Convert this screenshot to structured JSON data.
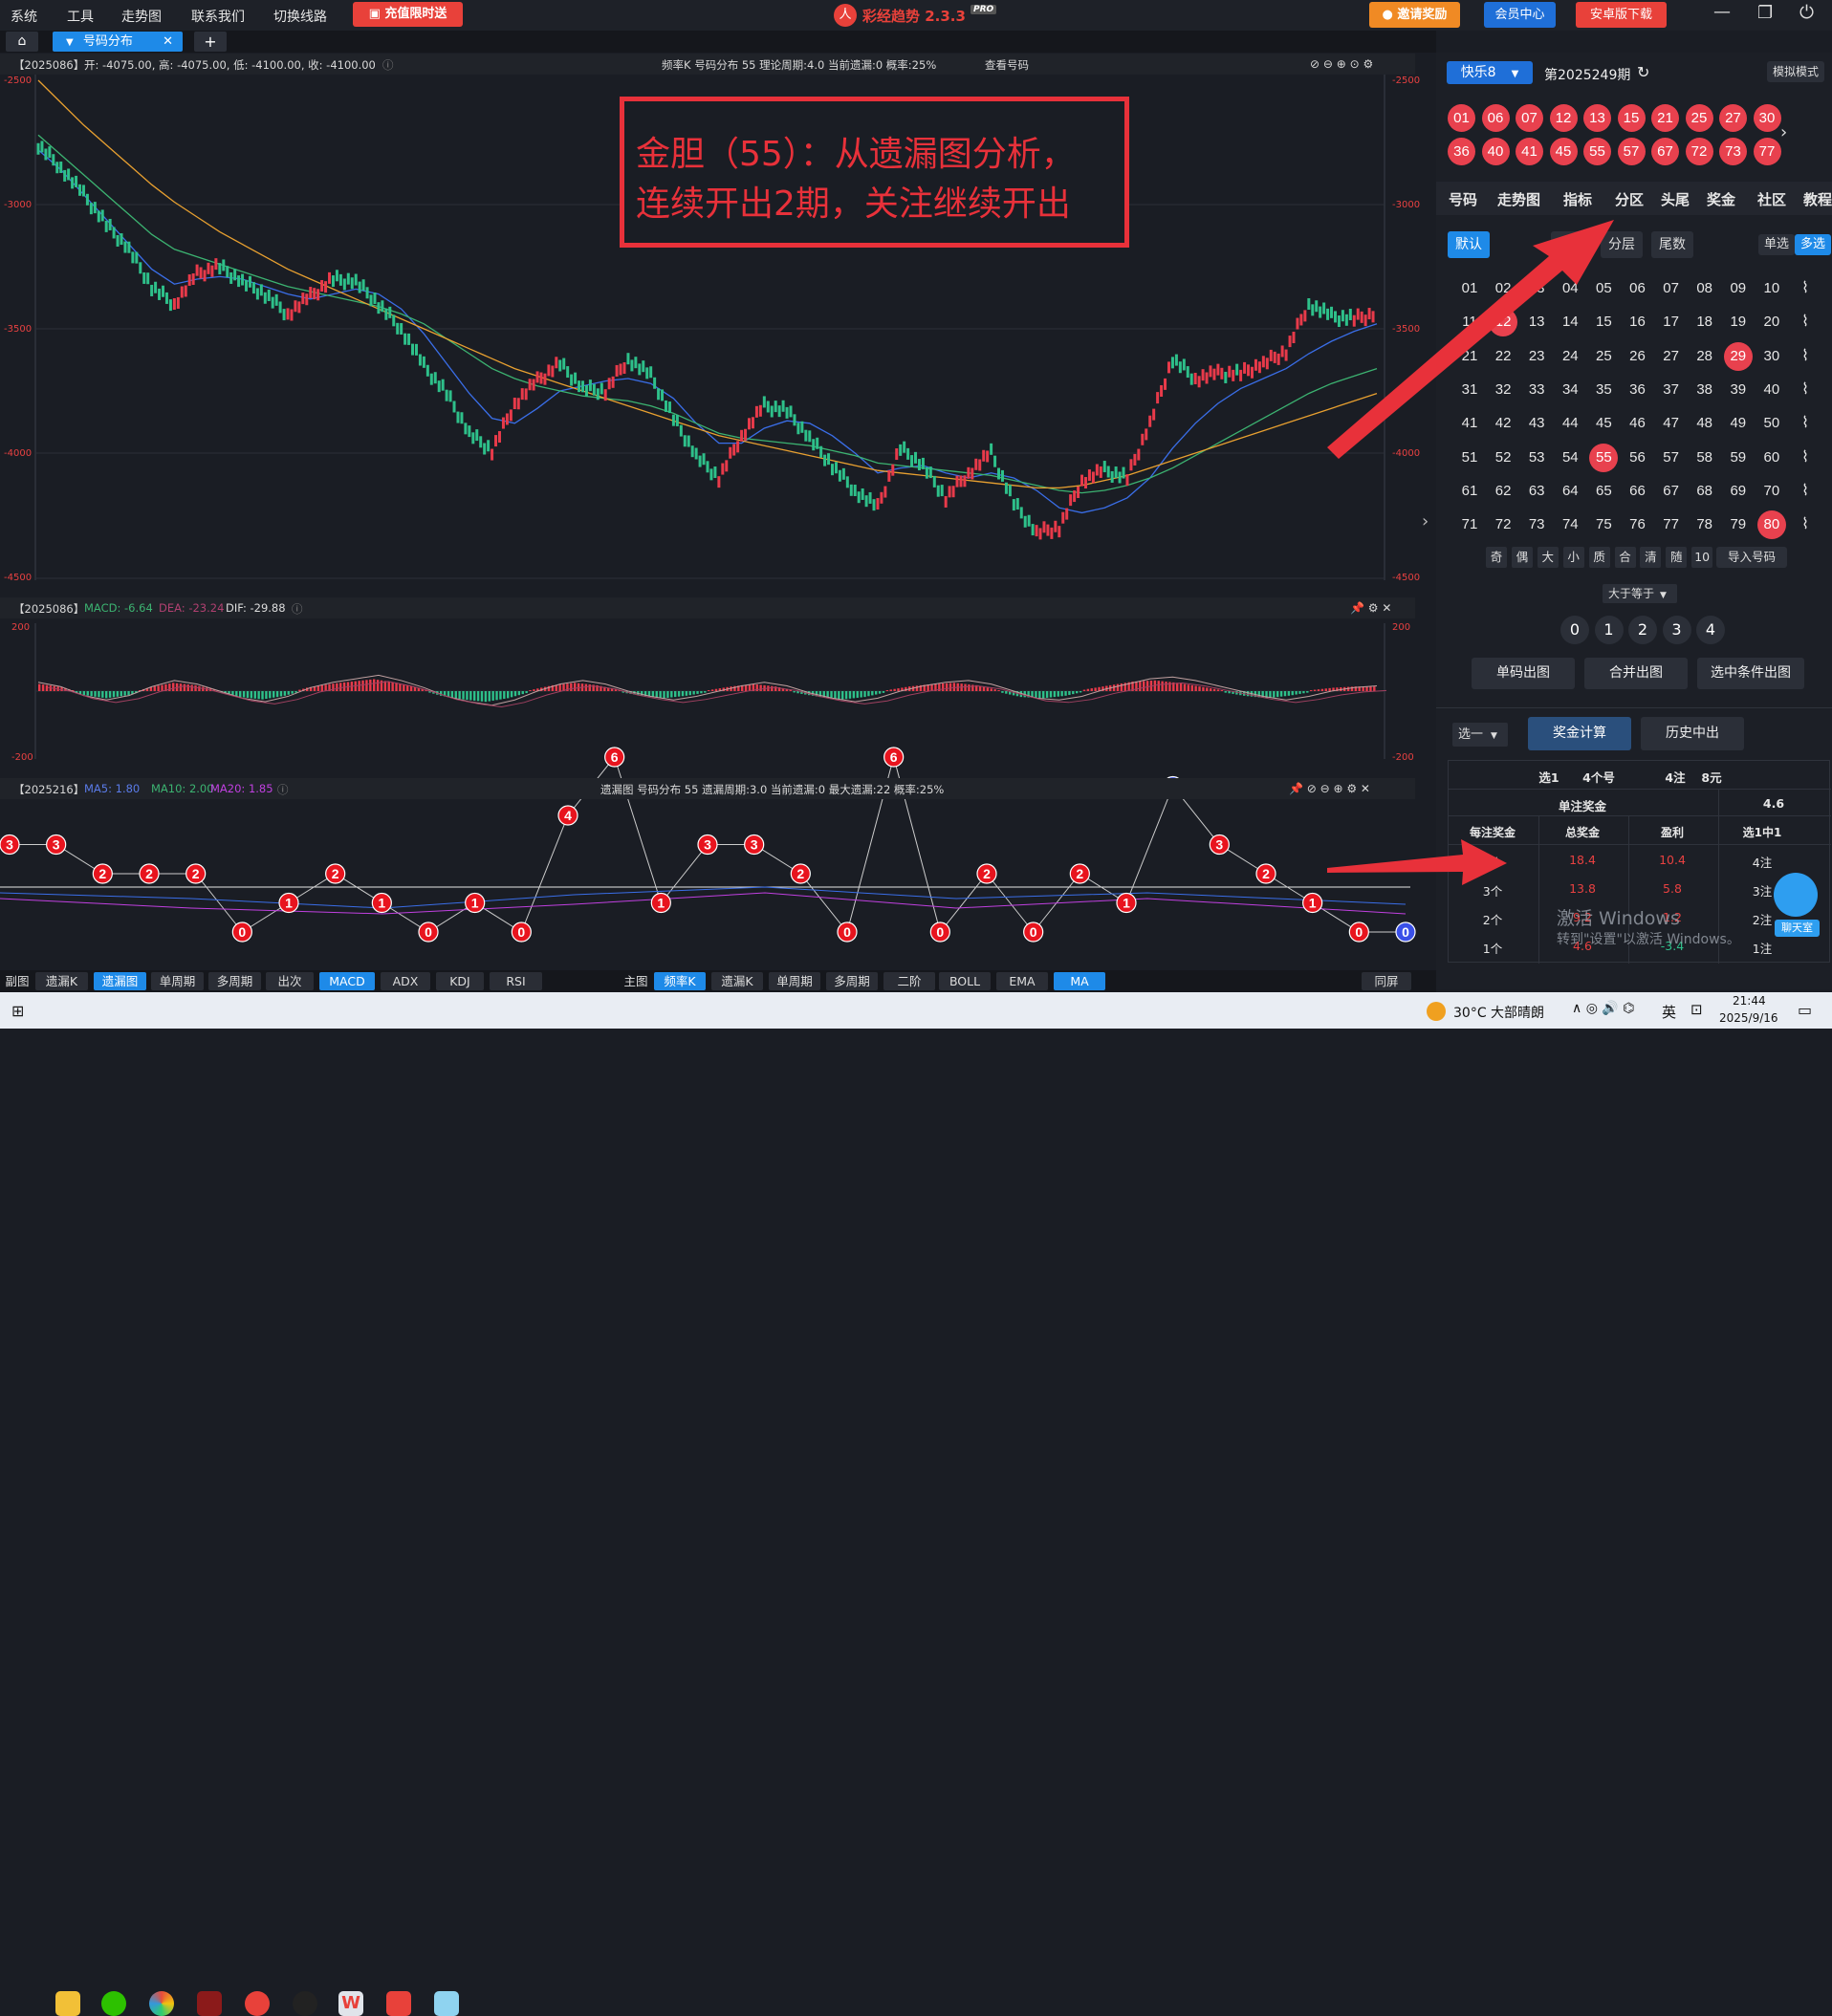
{
  "menu": [
    "系统",
    "工具",
    "走势图",
    "联系我们",
    "切换线路"
  ],
  "promo_label": "充值限时送",
  "app_title": "彩经趋势 2.3.3",
  "app_badge": "PRO",
  "invite_label": "邀请奖励",
  "member_label": "会员中心",
  "android_label": "安卓版下载",
  "tab": {
    "label": "号码分布"
  },
  "kline_header": {
    "period": "【2025086】",
    "ohlc": "开: -4075.00, 高: -4075.00, 低: -4100.00, 收: -4100.00",
    "center": "频率K   号码分布  55     理论周期:4.0   当前遗漏:0   概率:25%",
    "check": "查看号码"
  },
  "annotation": {
    "line1": "金胆（55）：从遗漏图分析，",
    "line2": "连续开出2期，关注继续开出"
  },
  "kline_axis": {
    "left": [
      "-2500",
      "-3000",
      "-3500",
      "-4000",
      "-4500"
    ],
    "right": [
      "-2500",
      "-3000",
      "-3500",
      "-4000",
      "-4500"
    ]
  },
  "macd_header": {
    "period": "【2025086】",
    "macd": "MACD: -6.64",
    "dea": "DEA: -23.24",
    "dif": "DIF: -29.88"
  },
  "macd_axis": {
    "top": "200",
    "bottom": "-200"
  },
  "omit_header": {
    "period": "【2025216】",
    "ma5": "MA5: 1.80",
    "ma10": "MA10: 2.00",
    "ma20": "MA20: 1.85",
    "center": "遗漏图    号码分布   55      遗漏周期:3.0    当前遗漏:0    最大遗漏:22    概率:25%"
  },
  "chart_data": [
    {
      "type": "line",
      "title": "频率K 号码分布 55",
      "ylim": [
        -4500,
        -2500
      ],
      "series": [
        {
          "name": "K",
          "values": [
            -2760,
            -2850,
            -2960,
            -3080,
            -3180,
            -3330,
            -3400,
            -3280,
            -3250,
            -3310,
            -3360,
            -3440,
            -3370,
            -3300,
            -3310,
            -3400,
            -3500,
            -3650,
            -3760,
            -3920,
            -3990,
            -3800,
            -3710,
            -3640,
            -3740,
            -3750,
            -3620,
            -3690,
            -3860,
            -4010,
            -4100,
            -3930,
            -3810,
            -3830,
            -3940,
            -4050,
            -4150,
            -4220,
            -3980,
            -4050,
            -4180,
            -4080,
            -4000,
            -4200,
            -4320,
            -4300,
            -4110,
            -4070,
            -4100,
            -3880,
            -3620,
            -3700,
            -3680,
            -3680,
            -3640,
            -3590,
            -3400,
            -3450,
            -3460,
            -3440
          ]
        },
        {
          "name": "MA5",
          "values": [
            -2780,
            -2860,
            -2960,
            -3060,
            -3160,
            -3260,
            -3320,
            -3300,
            -3290,
            -3300,
            -3330,
            -3360,
            -3380,
            -3360,
            -3340,
            -3360,
            -3420,
            -3520,
            -3640,
            -3760,
            -3860,
            -3880,
            -3820,
            -3750,
            -3730,
            -3710,
            -3700,
            -3720,
            -3780,
            -3880,
            -3960,
            -3960,
            -3900,
            -3870,
            -3880,
            -3930,
            -4000,
            -4080,
            -4060,
            -4050,
            -4080,
            -4100,
            -4080,
            -4100,
            -4150,
            -4220,
            -4240,
            -4220,
            -4180,
            -4100,
            -3980,
            -3880,
            -3800,
            -3740,
            -3700,
            -3660,
            -3600,
            -3550,
            -3510,
            -3480
          ]
        },
        {
          "name": "MA10",
          "values": [
            -2720,
            -2800,
            -2880,
            -2960,
            -3040,
            -3120,
            -3180,
            -3210,
            -3240,
            -3270,
            -3300,
            -3330,
            -3350,
            -3370,
            -3390,
            -3410,
            -3440,
            -3480,
            -3540,
            -3600,
            -3660,
            -3700,
            -3730,
            -3750,
            -3770,
            -3780,
            -3790,
            -3810,
            -3840,
            -3880,
            -3920,
            -3940,
            -3950,
            -3960,
            -3970,
            -3990,
            -4010,
            -4040,
            -4050,
            -4060,
            -4070,
            -4080,
            -4090,
            -4110,
            -4130,
            -4150,
            -4160,
            -4150,
            -4130,
            -4100,
            -4060,
            -4010,
            -3960,
            -3910,
            -3860,
            -3810,
            -3760,
            -3720,
            -3690,
            -3660
          ]
        },
        {
          "name": "MA20",
          "values": [
            -2500,
            -2590,
            -2680,
            -2760,
            -2840,
            -2920,
            -2990,
            -3050,
            -3110,
            -3160,
            -3210,
            -3260,
            -3300,
            -3340,
            -3380,
            -3420,
            -3460,
            -3500,
            -3540,
            -3580,
            -3620,
            -3660,
            -3690,
            -3720,
            -3750,
            -3780,
            -3810,
            -3840,
            -3870,
            -3900,
            -3930,
            -3950,
            -3970,
            -3990,
            -4010,
            -4030,
            -4050,
            -4070,
            -4080,
            -4090,
            -4100,
            -4110,
            -4120,
            -4130,
            -4140,
            -4140,
            -4130,
            -4110,
            -4090,
            -4060,
            -4030,
            -4000,
            -3970,
            -3940,
            -3910,
            -3880,
            -3850,
            -3820,
            -3790,
            -3760
          ]
        }
      ]
    },
    {
      "type": "bar",
      "title": "MACD",
      "ylim": [
        -200,
        200
      ],
      "series": [
        {
          "name": "MACD",
          "values": [
            10,
            5,
            -5,
            -10,
            -5,
            5,
            12,
            8,
            0,
            -8,
            -12,
            -6,
            4,
            10,
            14,
            18,
            12,
            4,
            -6,
            -12,
            -16,
            -10,
            0,
            8,
            12,
            8,
            0,
            -6,
            -10,
            -6,
            0,
            6,
            10,
            6,
            -2,
            -8,
            -12,
            -8,
            0,
            6,
            10,
            12,
            8,
            0,
            -8,
            -10,
            -6,
            2,
            8,
            14,
            16,
            12,
            6,
            0,
            -6,
            -10,
            -6,
            0,
            4,
            6
          ]
        }
      ]
    },
    {
      "type": "scatter",
      "title": "遗漏图 号码分布 55",
      "series": [
        {
          "name": "遗漏",
          "values": [
            3,
            3,
            2,
            2,
            2,
            0,
            1,
            2,
            1,
            0,
            1,
            0,
            4,
            6,
            1,
            3,
            3,
            2,
            0,
            6,
            0,
            2,
            0,
            2,
            1,
            5,
            3,
            2,
            1,
            0,
            0
          ]
        }
      ]
    }
  ],
  "right": {
    "lottery": "快乐8",
    "issue": "第2025249期",
    "mode": "模拟模式",
    "draw_row1": [
      "01",
      "06",
      "07",
      "12",
      "13",
      "15",
      "21",
      "25",
      "27",
      "30"
    ],
    "draw_row2": [
      "36",
      "40",
      "41",
      "45",
      "55",
      "57",
      "67",
      "72",
      "73",
      "77"
    ],
    "nav_tabs": [
      "号码",
      "走势图",
      "指标",
      "分区",
      "头尾",
      "奖金",
      "社区",
      "教程"
    ],
    "subtabs": [
      "默认",
      "冷热",
      "分层",
      "尾数"
    ],
    "single": "单选",
    "multi": "多选",
    "grid": [
      [
        "01",
        "02",
        "03",
        "04",
        "05",
        "06",
        "07",
        "08",
        "09",
        "10"
      ],
      [
        "11",
        "12",
        "13",
        "14",
        "15",
        "16",
        "17",
        "18",
        "19",
        "20"
      ],
      [
        "21",
        "22",
        "23",
        "24",
        "25",
        "26",
        "27",
        "28",
        "29",
        "30"
      ],
      [
        "31",
        "32",
        "33",
        "34",
        "35",
        "36",
        "37",
        "38",
        "39",
        "40"
      ],
      [
        "41",
        "42",
        "43",
        "44",
        "45",
        "46",
        "47",
        "48",
        "49",
        "50"
      ],
      [
        "51",
        "52",
        "53",
        "54",
        "55",
        "56",
        "57",
        "58",
        "59",
        "60"
      ],
      [
        "61",
        "62",
        "63",
        "64",
        "65",
        "66",
        "67",
        "68",
        "69",
        "70"
      ],
      [
        "71",
        "72",
        "73",
        "74",
        "75",
        "76",
        "77",
        "78",
        "79",
        "80"
      ]
    ],
    "filters": [
      "奇",
      "偶",
      "大",
      "小",
      "质",
      "合",
      "清",
      "随",
      "10"
    ],
    "import": "导入号码",
    "ge": "大于等于",
    "omits": [
      "0",
      "1",
      "2",
      "3",
      "4"
    ],
    "btn_single": "单码出图",
    "btn_merge": "合并出图",
    "btn_cond": "选中条件出图",
    "pick": "选一",
    "calc": "奖金计算",
    "history": "历史中出",
    "summary": [
      "选1",
      "4个号",
      "4注",
      "8元"
    ],
    "single_bonus_label": "单注奖金",
    "single_bonus_value": "4.6",
    "col_headers": [
      "每注奖金",
      "总奖金",
      "盈利",
      "选1中1"
    ],
    "rows": [
      [
        "4个",
        "18.4",
        "10.4",
        "4注"
      ],
      [
        "3个",
        "13.8",
        "5.8",
        "3注"
      ],
      [
        "2个",
        "9.2",
        "1.2",
        "2注"
      ],
      [
        "1个",
        "4.6",
        "-3.4",
        "1注"
      ]
    ],
    "activate1": "激活 Windows",
    "activate2": "转到\"设置\"以激活 Windows。",
    "chat": "聊天室"
  },
  "bottom_left": [
    "副图",
    "遗漏K",
    "遗漏图",
    "单周期",
    "多周期",
    "出次",
    "MACD",
    "ADX",
    "KDJ",
    "RSI"
  ],
  "bottom_right": [
    "主图",
    "频率K",
    "遗漏K",
    "单周期",
    "多周期",
    "二阶",
    "BOLL",
    "EMA",
    "MA"
  ],
  "sync": "同屏",
  "taskbar": {
    "weather": "30°C  大部晴朗",
    "ime": "英",
    "time": "21:44",
    "date": "2025/9/16"
  }
}
